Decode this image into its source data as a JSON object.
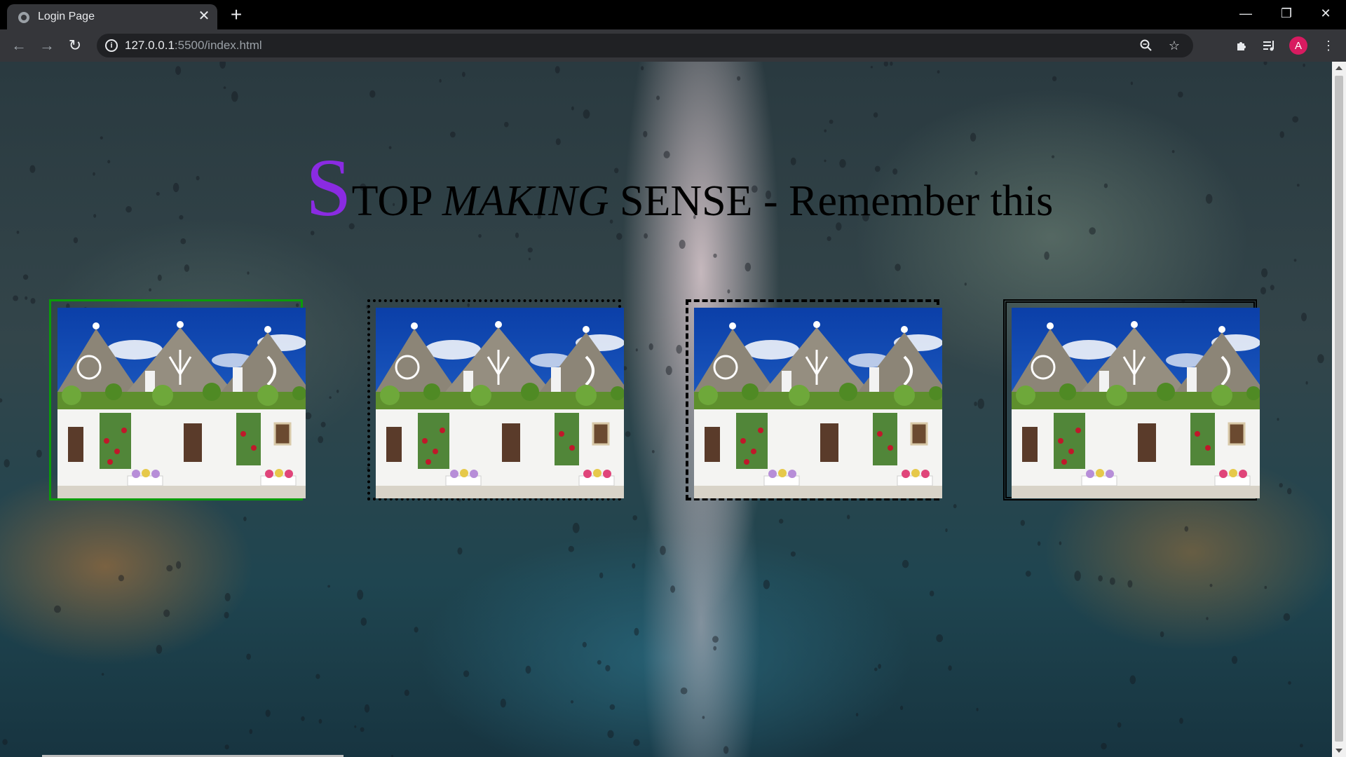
{
  "browser": {
    "tab_title": "Login Page",
    "url_host": "127.0.0.1",
    "url_rest": ":5500/index.html",
    "profile_initial": "A"
  },
  "page": {
    "heading": {
      "first_letter": "S",
      "part1": "TOP ",
      "italic": "MAKING",
      "part2": " SENSE - Remember this"
    },
    "gallery": [
      {
        "name": "image-frame-solid-green",
        "border_color": "#0a9b0a"
      },
      {
        "name": "image-frame-dotted",
        "border_color": "#000000"
      },
      {
        "name": "image-frame-dashed",
        "border_color": "#000000"
      },
      {
        "name": "image-frame-double",
        "border_color": "#000000"
      }
    ],
    "accent_color": "#8a2be2"
  }
}
